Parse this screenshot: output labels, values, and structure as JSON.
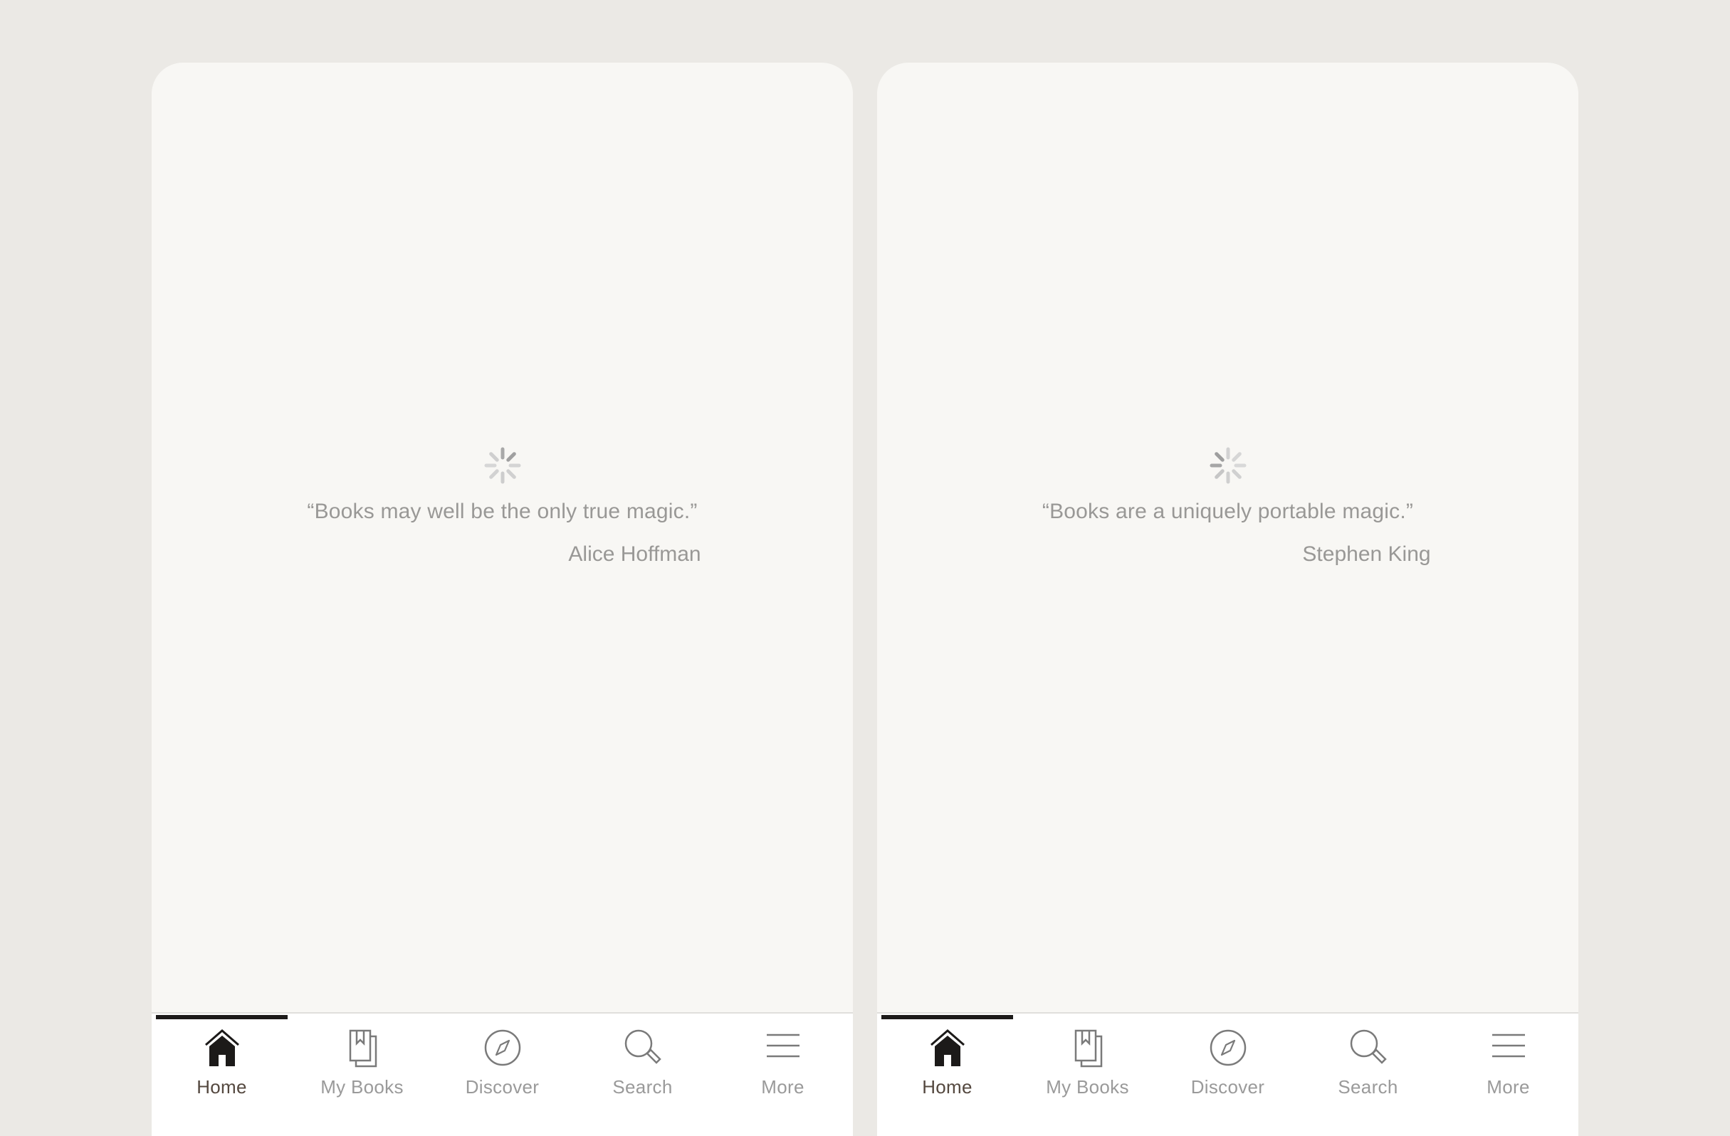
{
  "colors": {
    "background": "#ebe9e5",
    "panel": "#f8f7f4",
    "tabbar": "#ffffff",
    "text_muted": "#999896",
    "active_label": "#54483f",
    "active_indicator": "#1c1a19"
  },
  "screens": [
    {
      "loading_icon": "spinner-icon",
      "quote": "“Books may well be the only true magic.”",
      "author": "Alice Hoffman",
      "tabs": [
        {
          "label": "Home",
          "icon": "home-icon",
          "active": true
        },
        {
          "label": "My Books",
          "icon": "books-icon",
          "active": false
        },
        {
          "label": "Discover",
          "icon": "compass-icon",
          "active": false
        },
        {
          "label": "Search",
          "icon": "search-icon",
          "active": false
        },
        {
          "label": "More",
          "icon": "menu-icon",
          "active": false
        }
      ]
    },
    {
      "loading_icon": "spinner-icon",
      "quote": "“Books are a uniquely portable magic.”",
      "author": "Stephen King",
      "tabs": [
        {
          "label": "Home",
          "icon": "home-icon",
          "active": true
        },
        {
          "label": "My Books",
          "icon": "books-icon",
          "active": false
        },
        {
          "label": "Discover",
          "icon": "compass-icon",
          "active": false
        },
        {
          "label": "Search",
          "icon": "search-icon",
          "active": false
        },
        {
          "label": "More",
          "icon": "menu-icon",
          "active": false
        }
      ]
    }
  ]
}
